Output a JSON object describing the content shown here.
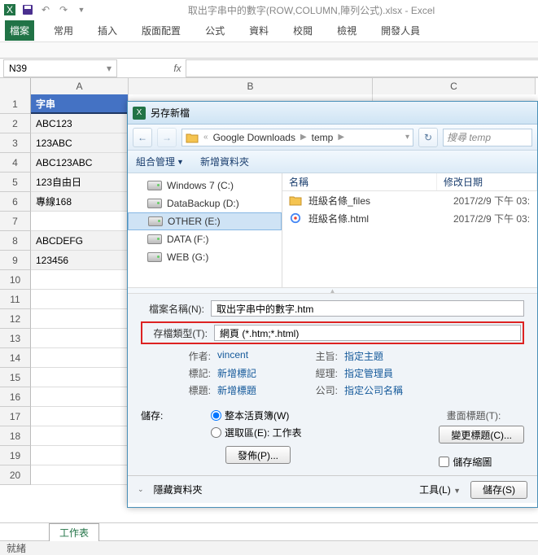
{
  "titlebar": {
    "title": "取出字串中的數字(ROW,COLUMN,陣列公式).xlsx - Excel"
  },
  "tabs": {
    "file": "檔案",
    "home": "常用",
    "insert": "插入",
    "layout": "版面配置",
    "formula": "公式",
    "data": "資料",
    "review": "校閱",
    "view": "檢視",
    "dev": "開發人員"
  },
  "namebox": "N39",
  "columns": {
    "A": "A",
    "B": "B",
    "C": "C"
  },
  "rows": [
    "1",
    "2",
    "3",
    "4",
    "5",
    "6",
    "7",
    "8",
    "9",
    "10",
    "11",
    "12",
    "13",
    "14",
    "15",
    "16",
    "17",
    "18",
    "19",
    "20"
  ],
  "cells": {
    "A1": "字串",
    "A2": "ABC123",
    "A3": "123ABC",
    "A4": "ABC123ABC",
    "A5": "123自由日",
    "A6": "專線168",
    "A7": "",
    "A8": "ABCDEFG",
    "A9": "123456"
  },
  "sheet_tab": "工作表",
  "statusbar": "就緒",
  "dialog": {
    "title": "另存新檔",
    "crumb1": "Google Downloads",
    "crumb2": "temp",
    "search": "搜尋 temp",
    "organize": "組合管理",
    "newfolder": "新增資料夾",
    "drives": {
      "c": "Windows 7 (C:)",
      "d": "DataBackup (D:)",
      "e": "OTHER (E:)",
      "f": "DATA (F:)",
      "g": "WEB (G:)"
    },
    "col_name": "名稱",
    "col_date": "修改日期",
    "files": [
      {
        "name": "班級名條_files",
        "date": "2017/2/9 下午 03:"
      },
      {
        "name": "班級名條.html",
        "date": "2017/2/9 下午 03:"
      }
    ],
    "filename_lbl": "檔案名稱(N):",
    "filename": "取出字串中的數字.htm",
    "filetype_lbl": "存檔類型(T):",
    "filetype": "網頁 (*.htm;*.html)",
    "author_lbl": "作者:",
    "author": "vincent",
    "tags_lbl": "標記:",
    "tags": "新增標記",
    "title_lbl": "標題:",
    "title2": "新增標題",
    "subject_lbl": "主旨:",
    "subject": "指定主題",
    "manager_lbl": "經理:",
    "manager": "指定管理員",
    "company_lbl": "公司:",
    "company": "指定公司名稱",
    "save_lbl": "儲存:",
    "whole": "整本活頁簿(W)",
    "select": "選取區(E): 工作表",
    "pagetitle_lbl": "畫面標題(T):",
    "changetitle": "變更標題(C)...",
    "publish": "發佈(P)...",
    "savethumb": "儲存縮圖",
    "hide": "隱藏資料夾",
    "tools": "工具(L)",
    "save": "儲存(S)"
  }
}
